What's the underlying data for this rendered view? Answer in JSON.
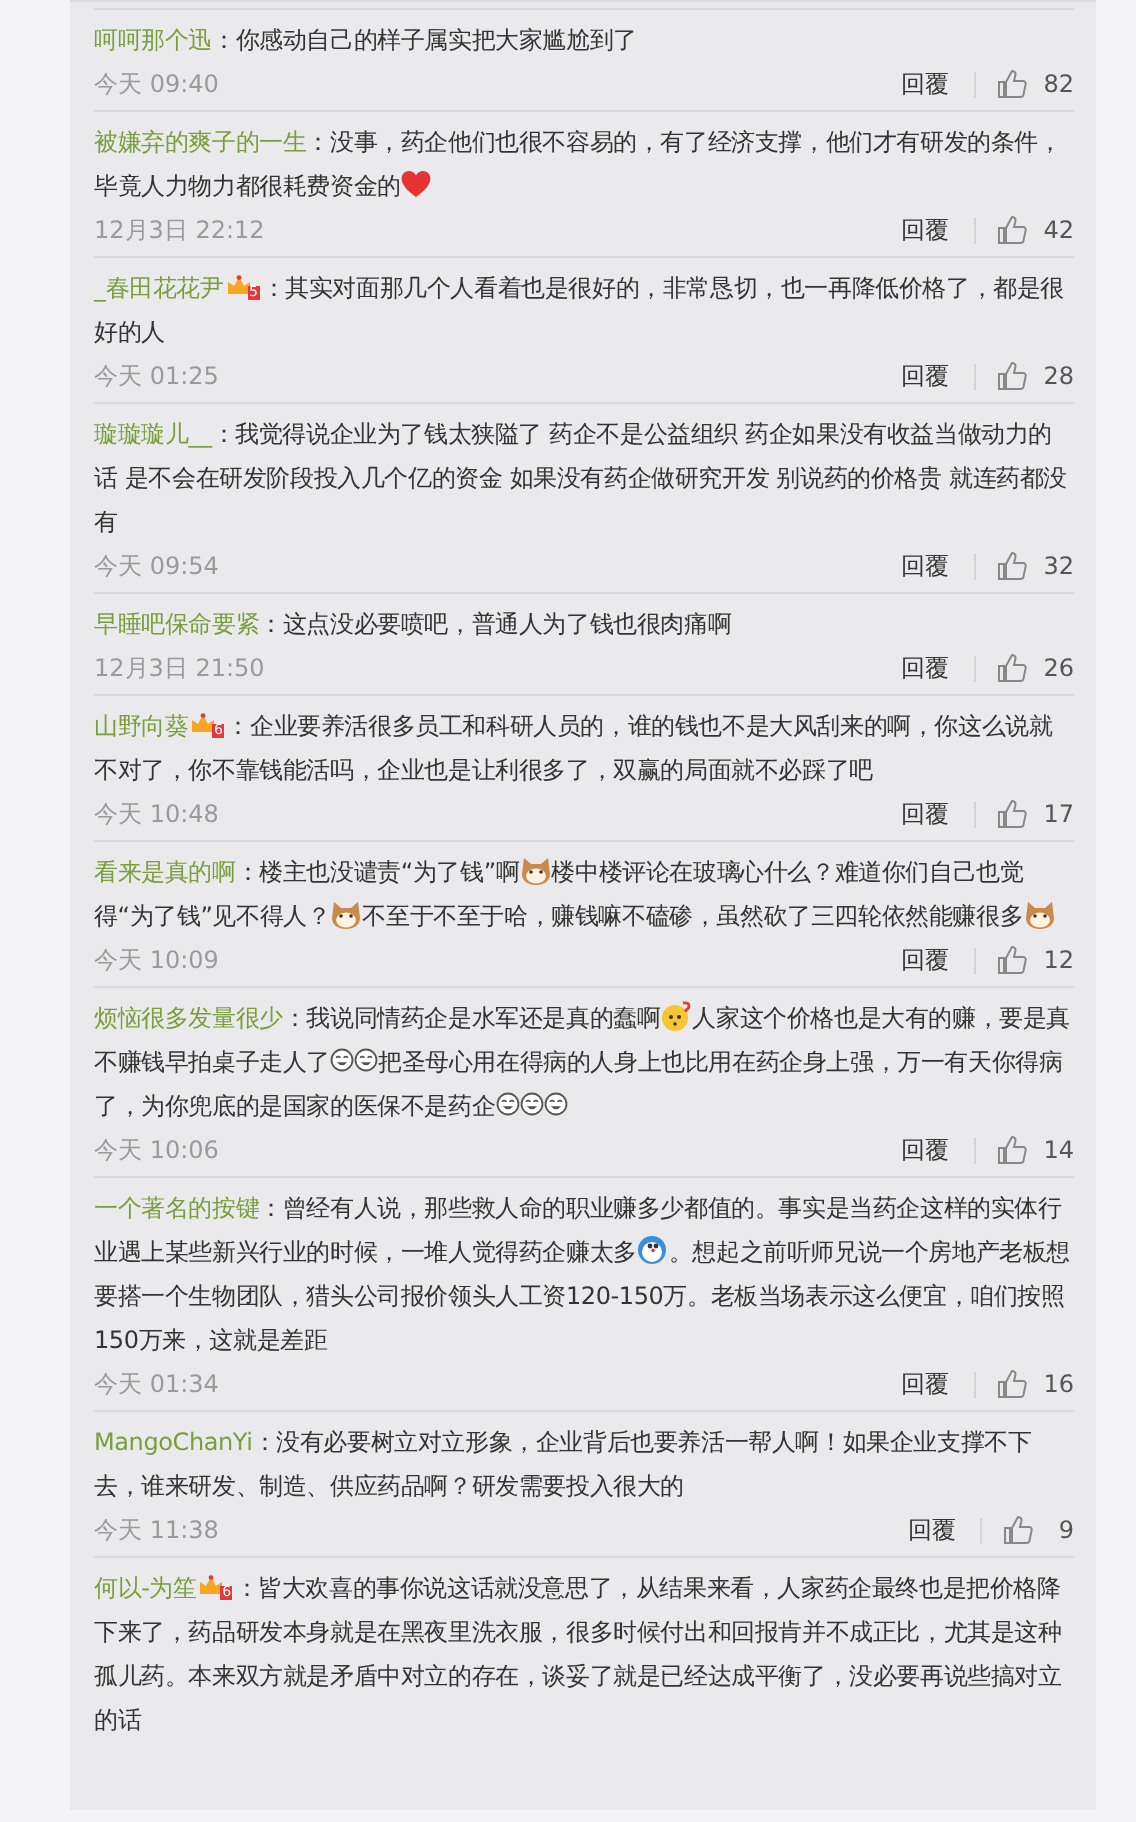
{
  "comments": [
    {
      "user": "呵呵那个迅",
      "segments": [
        {
          "kind": "text",
          "text": "：你感动自己的样子属实把大家尴尬到了"
        }
      ],
      "time": "今天 09:40",
      "reply": "回覆",
      "likes": "82"
    },
    {
      "user": "被嫌弃的爽子的一生",
      "segments": [
        {
          "kind": "text",
          "text": "：没事，药企他们也很不容易的，有了经济支撑，他们才有研发的条件，毕竟人力物力都很耗费资金的"
        },
        {
          "kind": "heart"
        }
      ],
      "time": "12月3日 22:12",
      "reply": "回覆",
      "likes": "42"
    },
    {
      "user": "_春田花花尹",
      "badge": "5",
      "segments": [
        {
          "kind": "text",
          "text": "：其实对面那几个人看着也是很好的，非常恳切，也一再降低价格了，都是很好的人"
        }
      ],
      "time": "今天 01:25",
      "reply": "回覆",
      "likes": "28"
    },
    {
      "user": "璇璇璇儿__",
      "segments": [
        {
          "kind": "text",
          "text": "：我觉得说企业为了钱太狭隘了 药企不是公益组织 药企如果没有收益当做动力的话 是不会在研发阶段投入几个亿的资金 如果没有药企做研究开发 别说药的价格贵 就连药都没有"
        }
      ],
      "time": "今天 09:54",
      "reply": "回覆",
      "likes": "32"
    },
    {
      "user": "早睡吧保命要紧",
      "segments": [
        {
          "kind": "text",
          "text": "：这点没必要喷吧，普通人为了钱也很肉痛啊"
        }
      ],
      "time": "12月3日 21:50",
      "reply": "回覆",
      "likes": "26"
    },
    {
      "user": "山野向葵",
      "badge": "6",
      "segments": [
        {
          "kind": "text",
          "text": "：企业要养活很多员工和科研人员的，谁的钱也不是大风刮来的啊，你这么说就不对了，你不靠钱能活吗，企业也是让利很多了，双赢的局面就不必踩了吧"
        }
      ],
      "time": "今天 10:48",
      "reply": "回覆",
      "likes": "17"
    },
    {
      "user": "看来是真的啊",
      "segments": [
        {
          "kind": "text",
          "text": "：楼主也没谴责“为了钱”啊"
        },
        {
          "kind": "cat"
        },
        {
          "kind": "text",
          "text": "楼中楼评论在玻璃心什么？难道你们自己也觉得“为了钱”见不得人？"
        },
        {
          "kind": "cat"
        },
        {
          "kind": "text",
          "text": "不至于不至于哈，赚钱嘛不磕碜，虽然砍了三四轮依然能赚很多"
        },
        {
          "kind": "cat"
        }
      ],
      "time": "今天 10:09",
      "reply": "回覆",
      "likes": "12"
    },
    {
      "user": "烦恼很多发量很少",
      "segments": [
        {
          "kind": "text",
          "text": "：我说同情药企是水军还是真的蠢啊"
        },
        {
          "kind": "puzzled"
        },
        {
          "kind": "text",
          "text": "人家这个价格也是大有的赚，要是真不赚钱早拍桌子走人了"
        },
        {
          "kind": "laugh"
        },
        {
          "kind": "laugh"
        },
        {
          "kind": "text",
          "text": "把圣母心用在得病的人身上也比用在药企身上强，万一有天你得病了，为你兜底的是国家的医保不是药企"
        },
        {
          "kind": "laugh"
        },
        {
          "kind": "laugh"
        },
        {
          "kind": "laugh"
        }
      ],
      "time": "今天 10:06",
      "reply": "回覆",
      "likes": "14"
    },
    {
      "user": "一个著名的按键",
      "segments": [
        {
          "kind": "text",
          "text": "：曾经有人说，那些救人命的职业赚多少都值的。事实是当药企这样的实体行业遇上某些新兴行业的时候，一堆人觉得药企赚太多"
        },
        {
          "kind": "round"
        },
        {
          "kind": "text",
          "text": "。想起之前听师兄说一个房地产老板想要搭一个生物团队，猎头公司报价领头人工资120-150万。老板当场表示这么便宜，咱们按照150万来，这就是差距"
        }
      ],
      "time": "今天 01:34",
      "reply": "回覆",
      "likes": "16"
    },
    {
      "user": "MangoChanYi",
      "segments": [
        {
          "kind": "text",
          "text": "：没有必要树立对立形象，企业背后也要养活一帮人啊！如果企业支撑不下去，谁来研发、制造、供应药品啊？研发需要投入很大的"
        }
      ],
      "time": "今天 11:38",
      "reply": "回覆",
      "likes": "9"
    },
    {
      "user": "何以-为笙",
      "badge": "6",
      "segments": [
        {
          "kind": "text",
          "text": "：皆大欢喜的事你说这话就没意思了，从结果来看，人家药企最终也是把价格降下来了，药品研发本身就是在黑夜里洗衣服，很多时候付出和回报肯并不成正比，尤其是这种孤儿药。本来双方就是矛盾中对立的存在，谈妥了就是已经达成平衡了，没必要再说些搞对立的话"
        }
      ]
    }
  ]
}
